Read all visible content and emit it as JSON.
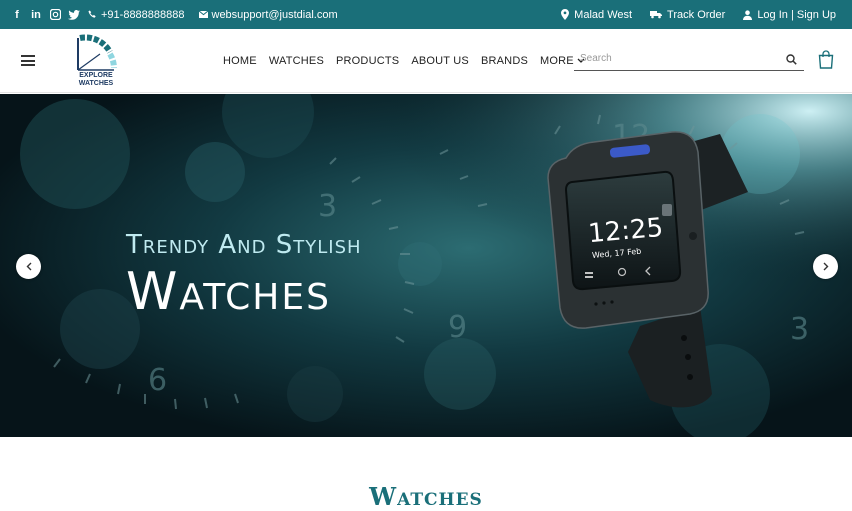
{
  "topbar": {
    "social": [
      {
        "name": "facebook",
        "glyph": "f"
      },
      {
        "name": "linkedin",
        "glyph": "in"
      },
      {
        "name": "instagram",
        "glyph": "◘"
      },
      {
        "name": "twitter",
        "glyph": "🐦"
      }
    ],
    "phone": "+91-8888888888",
    "email": "websupport@justdial.com",
    "location": "Malad West",
    "track_order": "Track Order",
    "login": "Log In | Sign Up"
  },
  "logo": {
    "line1": "EXPLORE",
    "line2": "WATCHES"
  },
  "nav": {
    "items": [
      "HOME",
      "WATCHES",
      "PRODUCTS",
      "ABOUT US",
      "BRANDS"
    ],
    "more": "MORE"
  },
  "search": {
    "placeholder": "Search"
  },
  "hero": {
    "title1": "Trendy And Stylish",
    "title2": "Watches",
    "watch_time": "12:25",
    "watch_date": "Wed, 17 Feb",
    "dial_numbers": [
      "3",
      "6",
      "9",
      "12",
      "3"
    ]
  },
  "section": {
    "title": "Watches"
  },
  "colors": {
    "brand": "#1a6f79",
    "hero_dark": "#071c22",
    "accent": "#8fd6e0"
  },
  "icons": [
    "menu-icon",
    "search-icon",
    "cart-icon",
    "phone-icon",
    "email-icon",
    "location-icon",
    "truck-icon",
    "user-icon",
    "chevron-left-icon",
    "chevron-right-icon",
    "chevron-down-icon"
  ]
}
